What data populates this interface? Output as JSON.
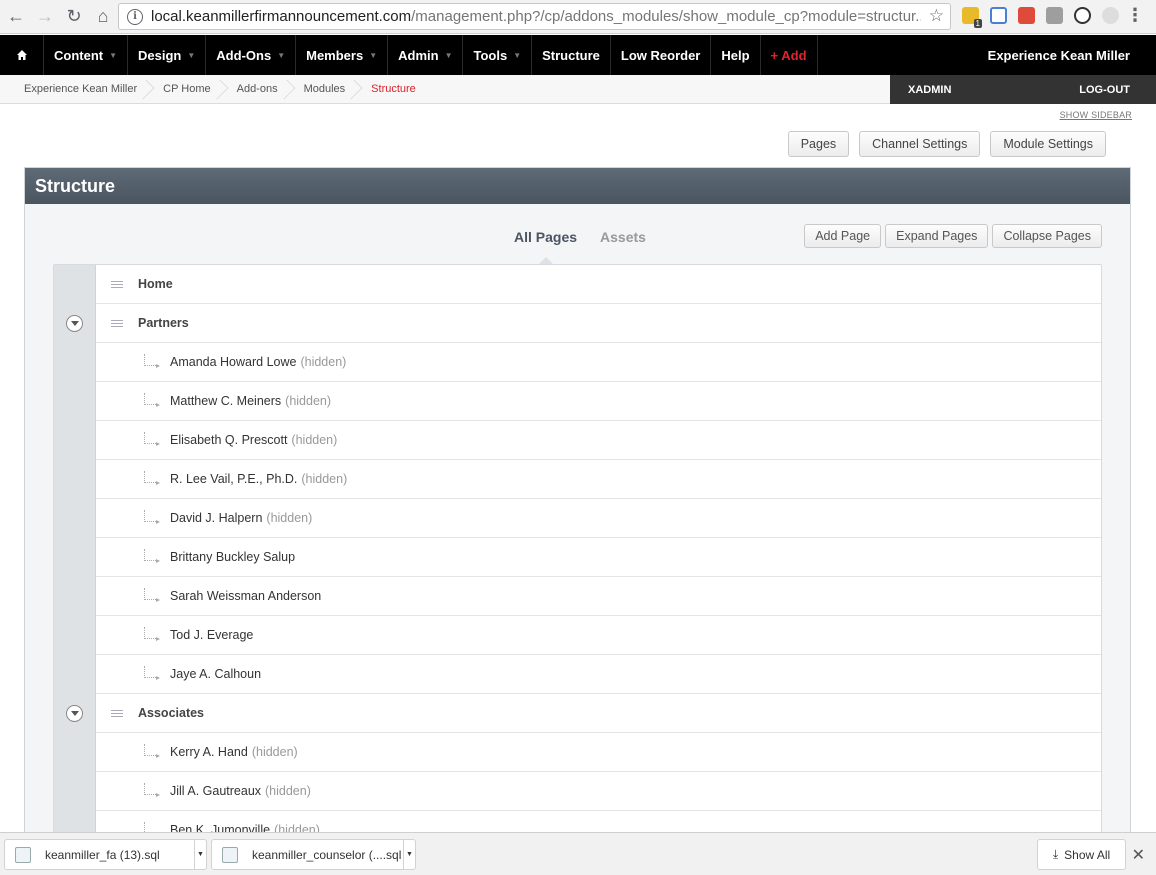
{
  "browser": {
    "url_host": "local.keanmillerfirmannouncement.com",
    "url_path": "/management.php?/cp/addons_modules/show_module_cp?module=structur...",
    "ext_badge": "1"
  },
  "cms_nav": {
    "items": [
      {
        "label": "Content",
        "caret": true
      },
      {
        "label": "Design",
        "caret": true
      },
      {
        "label": "Add-Ons",
        "caret": true
      },
      {
        "label": "Members",
        "caret": true
      },
      {
        "label": "Admin",
        "caret": true
      },
      {
        "label": "Tools",
        "caret": true
      },
      {
        "label": "Structure",
        "caret": false
      },
      {
        "label": "Low Reorder",
        "caret": false
      },
      {
        "label": "Help",
        "caret": false
      }
    ],
    "add_label": "+ Add",
    "site_name": "Experience Kean Miller"
  },
  "breadcrumbs": [
    "Experience Kean Miller",
    "CP Home",
    "Add-ons",
    "Modules",
    "Structure"
  ],
  "user": {
    "name": "XADMIN",
    "logout": "LOG-OUT"
  },
  "show_sidebar": "SHOW SIDEBAR",
  "top_buttons": [
    "Pages",
    "Channel Settings",
    "Module Settings"
  ],
  "panel": {
    "title": "Structure",
    "tabs": [
      {
        "label": "All Pages",
        "active": true
      },
      {
        "label": "Assets",
        "active": false
      }
    ],
    "buttons": [
      "Add Page",
      "Expand Pages",
      "Collapse Pages"
    ]
  },
  "tree": [
    {
      "label": "Home",
      "level": 0,
      "expandable": false
    },
    {
      "label": "Partners",
      "level": 0,
      "expandable": true
    },
    {
      "label": "Amanda Howard Lowe",
      "level": 1,
      "hidden": true
    },
    {
      "label": "Matthew C. Meiners",
      "level": 1,
      "hidden": true
    },
    {
      "label": "Elisabeth Q. Prescott",
      "level": 1,
      "hidden": true
    },
    {
      "label": "R. Lee Vail, P.E., Ph.D.",
      "level": 1,
      "hidden": true
    },
    {
      "label": "David J. Halpern",
      "level": 1,
      "hidden": true
    },
    {
      "label": "Brittany Buckley Salup",
      "level": 1,
      "hidden": false
    },
    {
      "label": "Sarah Weissman Anderson",
      "level": 1,
      "hidden": false
    },
    {
      "label": "Tod J. Everage",
      "level": 1,
      "hidden": false
    },
    {
      "label": "Jaye A. Calhoun",
      "level": 1,
      "hidden": false
    },
    {
      "label": "Associates",
      "level": 0,
      "expandable": true
    },
    {
      "label": "Kerry A. Hand",
      "level": 1,
      "hidden": true
    },
    {
      "label": "Jill A. Gautreaux",
      "level": 1,
      "hidden": true
    },
    {
      "label": "Ben K. Jumonville",
      "level": 1,
      "hidden": true
    }
  ],
  "hidden_tag": "(hidden)",
  "downloads": [
    {
      "name": "keanmiller_fa (13).sql"
    },
    {
      "name": "keanmiller_counselor (....sql"
    }
  ],
  "show_all": "Show All",
  "colors": {
    "accent_red": "#d9232c",
    "panel_header": "#56616c"
  }
}
